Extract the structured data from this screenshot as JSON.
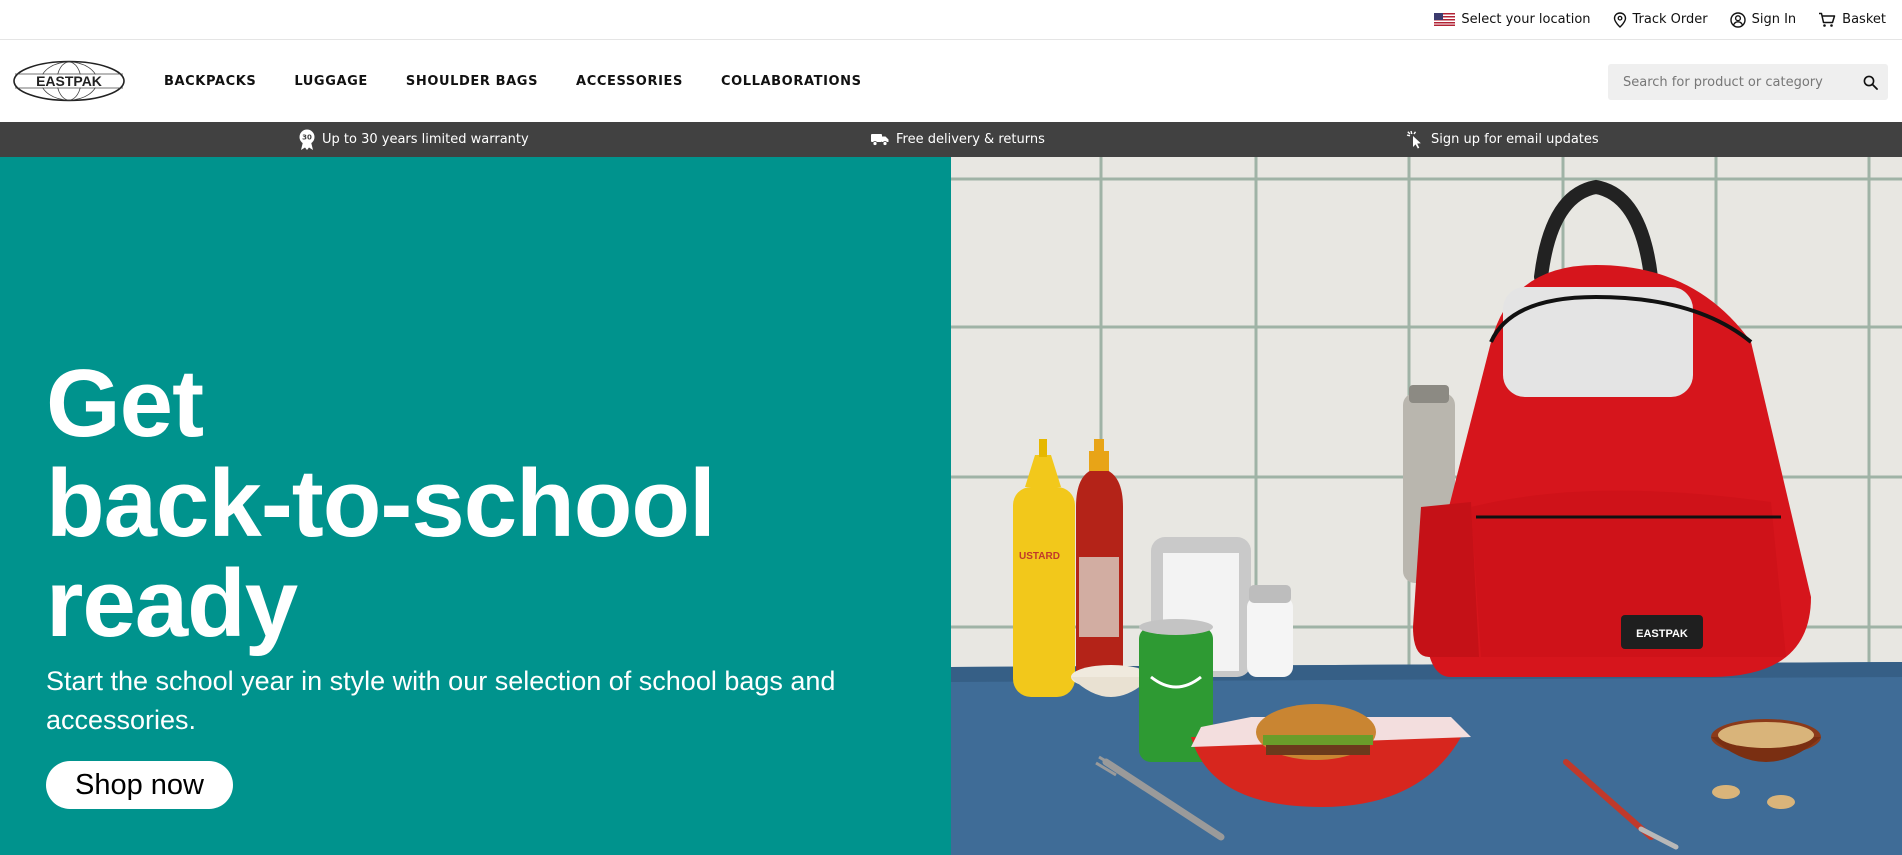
{
  "utility": {
    "location": "Select your location",
    "track": "Track Order",
    "signin": "Sign In",
    "basket": "Basket"
  },
  "header": {
    "logo_text": "EASTPAK",
    "nav": [
      "BACKPACKS",
      "LUGGAGE",
      "SHOULDER BAGS",
      "ACCESSORIES",
      "COLLABORATIONS"
    ],
    "search_placeholder": "Search for product or category"
  },
  "benefits": {
    "warranty": "Up to 30 years limited warranty",
    "warranty_badge": "30",
    "delivery": "Free delivery & returns",
    "email": "Sign up for email updates"
  },
  "hero": {
    "title_lines": [
      "Get",
      "back-to-school",
      "ready"
    ],
    "subtitle": "Start the school year in style with our selection of school bags and accessories.",
    "cta": "Shop now",
    "bag_label": "EASTPAK",
    "mustard_label": "USTARD",
    "bg_color": "#00938d"
  }
}
